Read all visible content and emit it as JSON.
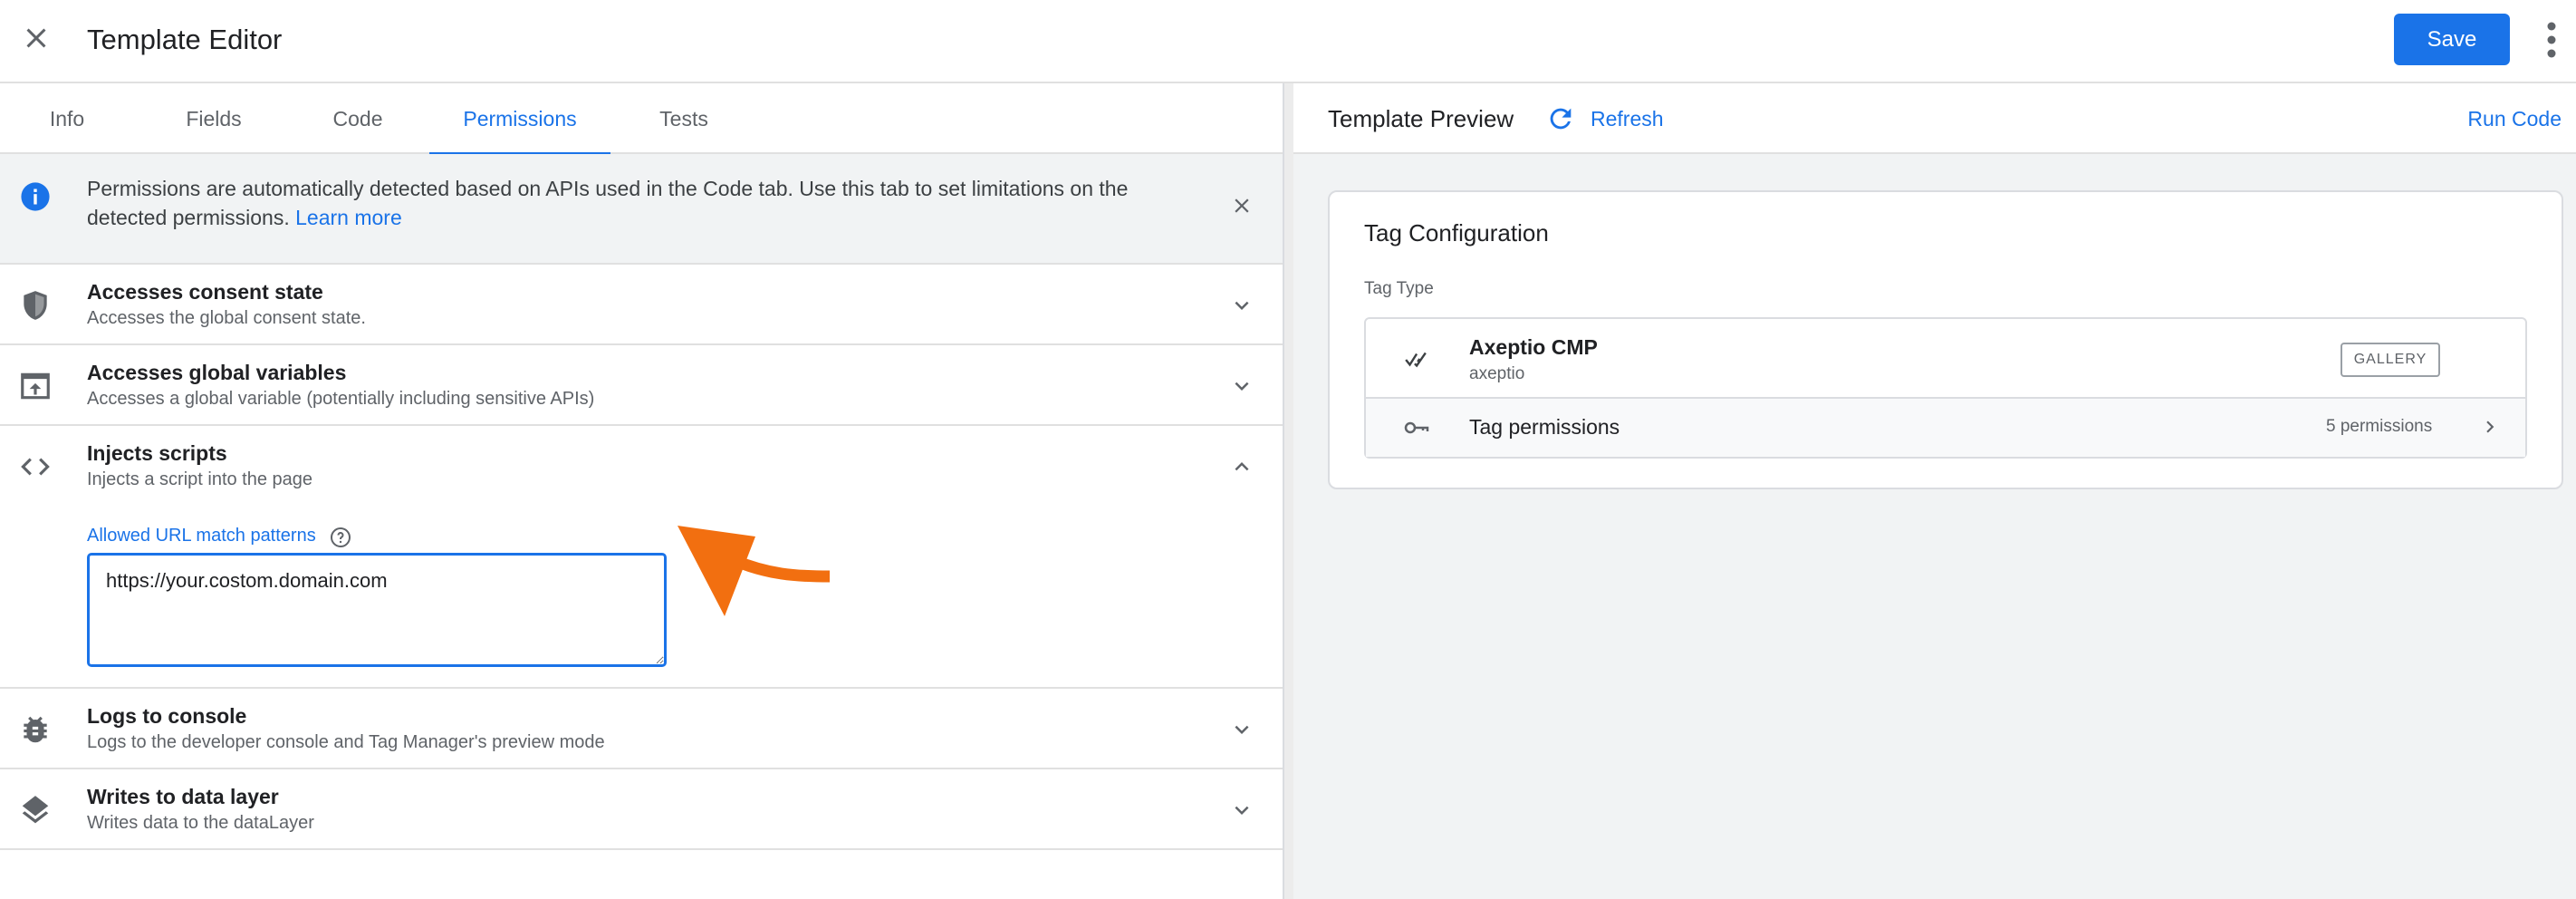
{
  "header": {
    "title": "Template Editor",
    "save_label": "Save"
  },
  "tabs": [
    {
      "label": "Info",
      "active": false
    },
    {
      "label": "Fields",
      "active": false
    },
    {
      "label": "Code",
      "active": false
    },
    {
      "label": "Permissions",
      "active": true
    },
    {
      "label": "Tests",
      "active": false
    }
  ],
  "banner": {
    "text": "Permissions are automatically detected based on APIs used in the Code tab. Use this tab to set limitations on the detected permissions.",
    "link": "Learn more"
  },
  "permissions": [
    {
      "title": "Accesses consent state",
      "subtitle": "Accesses the global consent state.",
      "icon": "shield-icon",
      "expanded": false
    },
    {
      "title": "Accesses global variables",
      "subtitle": "Accesses a global variable (potentially including sensitive APIs)",
      "icon": "upload-window-icon",
      "expanded": false
    },
    {
      "title": "Injects scripts",
      "subtitle": "Injects a script into the page",
      "icon": "code-icon",
      "expanded": true
    },
    {
      "title": "Logs to console",
      "subtitle": "Logs to the developer console and Tag Manager's preview mode",
      "icon": "bug-icon",
      "expanded": false
    },
    {
      "title": "Writes to data layer",
      "subtitle": "Writes data to the dataLayer",
      "icon": "layers-icon",
      "expanded": false
    }
  ],
  "inject_scripts_field": {
    "label": "Allowed URL match patterns",
    "value": "https://your.costom.domain.com"
  },
  "preview": {
    "title": "Template Preview",
    "refresh_label": "Refresh",
    "run_code_label": "Run Code",
    "card": {
      "title": "Tag Configuration",
      "tag_type_label": "Tag Type",
      "tag_name": "Axeptio CMP",
      "tag_vendor": "axeptio",
      "badge": "GALLERY",
      "permissions_label": "Tag permissions",
      "permissions_count": "5 permissions"
    }
  },
  "colors": {
    "accent": "#1a73e8",
    "arrow": "#f26f10"
  }
}
